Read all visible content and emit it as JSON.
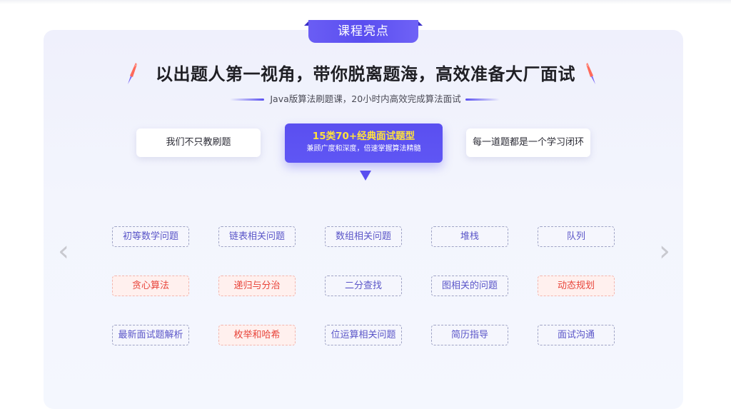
{
  "section": {
    "tab_label": "课程亮点",
    "headline": "以出题人第一视角，带你脱离题海，高效准备大厂面试",
    "subtitle": "Java版算法刷题课，20小时内高效完成算法面试"
  },
  "features": {
    "left": "我们不只教刷题",
    "active_title": "15类70+经典面试题型",
    "active_subtitle": "兼顾广度和深度，倍速掌握算法精髓",
    "right": "每一道题都是一个学习闭环"
  },
  "carousel": {
    "prev_glyph": "‹",
    "next_glyph": "›"
  },
  "tags": {
    "row1": [
      "初等数学问题",
      "链表相关问题",
      "数组相关问题",
      "堆栈",
      "队列"
    ],
    "row2": [
      "贪心算法",
      "递归与分治",
      "二分查找",
      "图相关的问题",
      "动态规划"
    ],
    "row3": [
      "最新面试题解析",
      "枚举和哈希",
      "位运算相关问题",
      "简历指导",
      "面试沟通"
    ]
  },
  "colors": {
    "accent": "#5a4ff0",
    "highlight_title": "#ffe23c",
    "hot_text": "#e8443a",
    "normal_tag_text": "#5a55c8"
  },
  "icons": {
    "decor": "rocket-icon",
    "pointer": "triangle-down-icon",
    "prev": "chevron-left-icon",
    "next": "chevron-right-icon"
  }
}
